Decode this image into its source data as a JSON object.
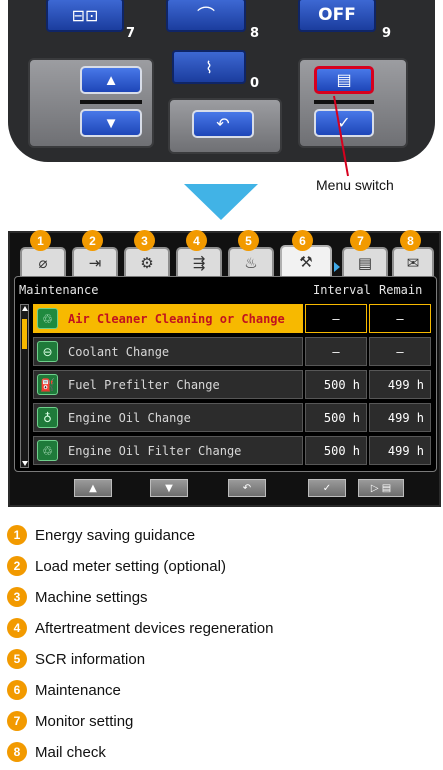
{
  "keypad": {
    "top_keys": [
      {
        "icon": "display-switch-icon",
        "glyph": "⊟⊡",
        "number": "7"
      },
      {
        "icon": "wiper-icon",
        "glyph": "⌒",
        "number": "8"
      },
      {
        "label": "OFF",
        "number": "9"
      }
    ],
    "defroster_key": {
      "icon": "defroster-icon",
      "glyph": "⌇",
      "number": "0"
    },
    "lower_buttons": [
      {
        "icon": "up-arrow-icon",
        "glyph": "▲"
      },
      {
        "icon": "down-arrow-icon",
        "glyph": "▼"
      },
      {
        "icon": "return-icon",
        "glyph": "↶"
      },
      {
        "icon": "menu-icon",
        "glyph": "▤"
      },
      {
        "icon": "check-icon",
        "glyph": "✓"
      }
    ],
    "callout_label": "Menu switch",
    "callout_color": "#d7001e"
  },
  "monitor": {
    "tabs": [
      {
        "badge": "1",
        "icon": "eco-leaf-icon",
        "glyph": "⌀"
      },
      {
        "badge": "2",
        "icon": "load-meter-icon",
        "glyph": "⇥"
      },
      {
        "badge": "3",
        "icon": "machine-settings-icon",
        "glyph": "⚙"
      },
      {
        "badge": "4",
        "icon": "aftertreatment-icon",
        "glyph": "⇶"
      },
      {
        "badge": "5",
        "icon": "scr-icon",
        "glyph": "♨"
      },
      {
        "badge": "6",
        "icon": "maintenance-icon",
        "glyph": "⚒"
      },
      {
        "badge": "7",
        "icon": "monitor-setting-icon",
        "glyph": "▤"
      },
      {
        "badge": "8",
        "icon": "mail-icon",
        "glyph": "✉"
      }
    ],
    "active_tab_index": 5,
    "list_header": {
      "title": "Maintenance",
      "col_interval": "Interval",
      "col_remain": "Remain"
    },
    "rows": [
      {
        "name": "Air Cleaner Cleaning or Change",
        "interval": "—",
        "remain": "—",
        "icon": "air-cleaner-icon",
        "glyph": "♲",
        "selected": true
      },
      {
        "name": "Coolant Change",
        "interval": "—",
        "remain": "—",
        "icon": "coolant-icon",
        "glyph": "⊖",
        "selected": false
      },
      {
        "name": "Fuel Prefilter Change",
        "interval": "500 h",
        "remain": "499 h",
        "icon": "fuel-prefilter-icon",
        "glyph": "⛽",
        "selected": false
      },
      {
        "name": "Engine Oil Change",
        "interval": "500 h",
        "remain": "499 h",
        "icon": "engine-oil-icon",
        "glyph": "♁",
        "selected": false
      },
      {
        "name": "Engine Oil Filter Change",
        "interval": "500 h",
        "remain": "499 h",
        "icon": "engine-oil-filter-icon",
        "glyph": "♲",
        "selected": false
      }
    ],
    "guide_icons": [
      {
        "icon": "up-arrow-icon",
        "glyph": "▲"
      },
      {
        "icon": "down-arrow-icon",
        "glyph": "▼"
      },
      {
        "icon": "return-icon",
        "glyph": "↶"
      },
      {
        "icon": "check-icon",
        "glyph": "✓"
      },
      {
        "icon": "next-menu-icon",
        "glyph": "▷ ▤"
      }
    ],
    "colors": {
      "highlight": "#f7b900",
      "selected_text": "#c1121f",
      "badge": "#f29a00",
      "pointer": "#3fa9e8"
    }
  },
  "legend": [
    {
      "number": "1",
      "text": "Energy saving guidance"
    },
    {
      "number": "2",
      "text": "Load meter setting (optional)"
    },
    {
      "number": "3",
      "text": "Machine settings"
    },
    {
      "number": "4",
      "text": "Aftertreatment devices regeneration"
    },
    {
      "number": "5",
      "text": "SCR information"
    },
    {
      "number": "6",
      "text": "Maintenance"
    },
    {
      "number": "7",
      "text": "Monitor setting"
    },
    {
      "number": "8",
      "text": "Mail check"
    }
  ]
}
